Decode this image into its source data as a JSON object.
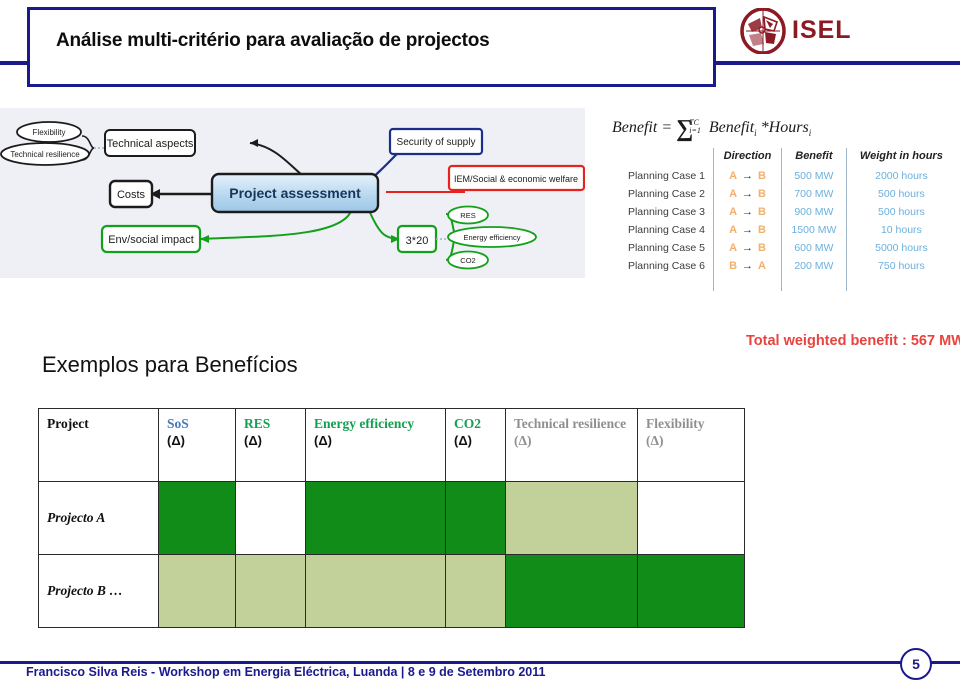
{
  "slide": {
    "title": "Análise multi-critério para avaliação de projectos",
    "logo_text": "ISEL",
    "section_heading": "Exemplos para Benefícios",
    "footer": "Francisco Silva Reis - Workshop em Energia Eléctrica, Luanda | 8 e 9 de Setembro 2011",
    "page_number": "5",
    "accent_color": "#1a1a8c",
    "logo_color": "#8c1a24"
  },
  "diagram": {
    "center": "Project assessment",
    "nodes": {
      "technical_aspects": "Technical aspects",
      "costs": "Costs",
      "env_social_impact": "Env/social impact",
      "security_of_supply": "Security of supply",
      "iem_welfare": "IEM/Social & economic welfare",
      "multiplier": "3*20"
    },
    "leaves": {
      "flexibility": "Flexibility",
      "technical_resilience": "Technical resilience",
      "res": "RES",
      "energy_efficiency": "Energy efficiency",
      "co2": "CO2"
    },
    "colors": {
      "background": "#eef0f5",
      "center_fill": "#bcd9ef",
      "blue": "#1a2f8c",
      "red": "#e8231f",
      "green": "#13a01a",
      "black": "#1c1c1c"
    }
  },
  "benefit_formula": {
    "lhs": "Benefit =",
    "sum_symbol": "∑",
    "sum_upper": "TC",
    "sum_lower": "i=1",
    "rhs_1": "Benefit",
    "rhs_sub_1": "i",
    "rhs_op": "*Hours",
    "rhs_sub_2": "i"
  },
  "planning_table": {
    "columns": [
      "",
      "Direction",
      "Benefit",
      "Weight in hours"
    ],
    "rows": [
      {
        "case": "Planning Case 1",
        "from": "A",
        "to": "B",
        "benefit": "500 MW",
        "weight": "2000 hours"
      },
      {
        "case": "Planning Case 2",
        "from": "A",
        "to": "B",
        "benefit": "700 MW",
        "weight": "500 hours"
      },
      {
        "case": "Planning Case 3",
        "from": "A",
        "to": "B",
        "benefit": "900 MW",
        "weight": "500 hours"
      },
      {
        "case": "Planning Case 4",
        "from": "A",
        "to": "B",
        "benefit": "1500 MW",
        "weight": "10 hours"
      },
      {
        "case": "Planning Case 5",
        "from": "A",
        "to": "B",
        "benefit": "600 MW",
        "weight": "5000 hours"
      },
      {
        "case": "Planning Case 6",
        "from": "B",
        "to": "A",
        "benefit": "200 MW",
        "weight": "750 hours"
      }
    ],
    "total_label": "Total weighted benefit : 567 MW",
    "arrow_glyph": "→"
  },
  "main_table": {
    "headers": [
      {
        "name": "Project",
        "delta": ""
      },
      {
        "name": "SoS",
        "delta": "(Δ)"
      },
      {
        "name": "RES",
        "delta": "(Δ)"
      },
      {
        "name": "Energy efficiency",
        "delta": "(Δ)"
      },
      {
        "name": "CO2",
        "delta": "(Δ)"
      },
      {
        "name": "Technical resilience",
        "delta": "(Δ)"
      },
      {
        "name": "Flexibility",
        "delta": "(Δ)"
      }
    ],
    "rows": [
      {
        "project": "Projecto A",
        "cells": [
          "dark",
          "white",
          "dark",
          "dark",
          "light",
          "white"
        ]
      },
      {
        "project": "Projecto B …",
        "cells": [
          "light",
          "light",
          "light",
          "light",
          "dark",
          "dark"
        ]
      }
    ],
    "colors": {
      "dark": "#118c18",
      "light": "#c2d199",
      "white": "#ffffff"
    }
  }
}
